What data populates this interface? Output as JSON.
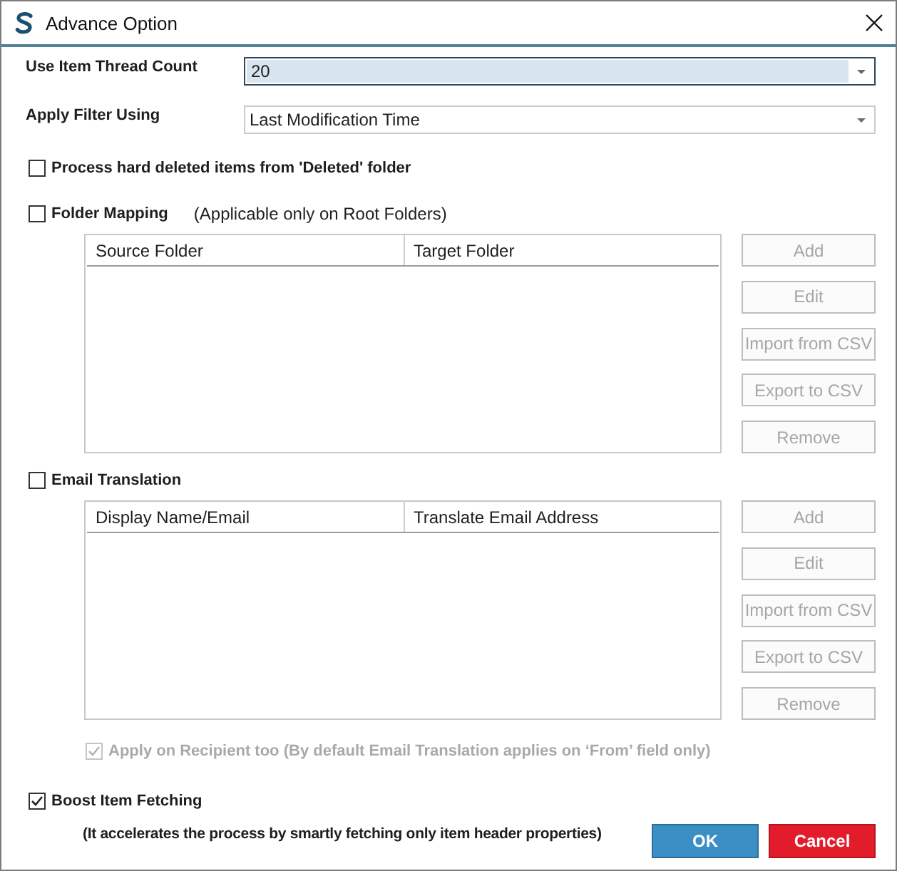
{
  "window": {
    "title": "Advance Option"
  },
  "settings": [
    {
      "kind": "combo",
      "label": "Use Item Thread Count",
      "value": "20",
      "focused": true
    },
    {
      "kind": "combo",
      "label": "Apply Filter Using",
      "value": "Last Modification Time",
      "focused": false
    }
  ],
  "process_hard_deleted": {
    "label": "Process hard deleted items from 'Deleted' folder",
    "checked": false
  },
  "sections": [
    {
      "label": "Folder Mapping",
      "note": "(Applicable only on Root Folders)",
      "checked": false,
      "columns": [
        "Source Folder",
        "Target Folder"
      ],
      "buttons": [
        {
          "label": "Add",
          "disabled": true
        },
        {
          "label": "Edit",
          "disabled": true
        },
        {
          "label": "Import from CSV",
          "disabled": true
        },
        {
          "label": "Export to CSV",
          "disabled": true
        },
        {
          "label": "Remove",
          "disabled": true
        }
      ]
    },
    {
      "label": "Email Translation",
      "checked": false,
      "columns": [
        "Display Name/Email",
        "Translate Email Address"
      ],
      "buttons": [
        {
          "label": "Add",
          "disabled": true
        },
        {
          "label": "Edit",
          "disabled": true
        },
        {
          "label": "Import from CSV",
          "disabled": true
        },
        {
          "label": "Export to CSV",
          "disabled": true
        },
        {
          "label": "Remove",
          "disabled": true
        }
      ],
      "sub_option": {
        "label": "Apply on Recipient too (By default Email Translation applies on ‘From’ field only)",
        "checked": true,
        "disabled": true
      }
    }
  ],
  "boost": {
    "label": "Boost Item Fetching",
    "checked": true,
    "note": "(It accelerates the process by smartly fetching only item header properties)"
  },
  "buttons": [
    {
      "kind": "primary",
      "label": "OK"
    },
    {
      "kind": "danger",
      "label": "Cancel"
    }
  ]
}
